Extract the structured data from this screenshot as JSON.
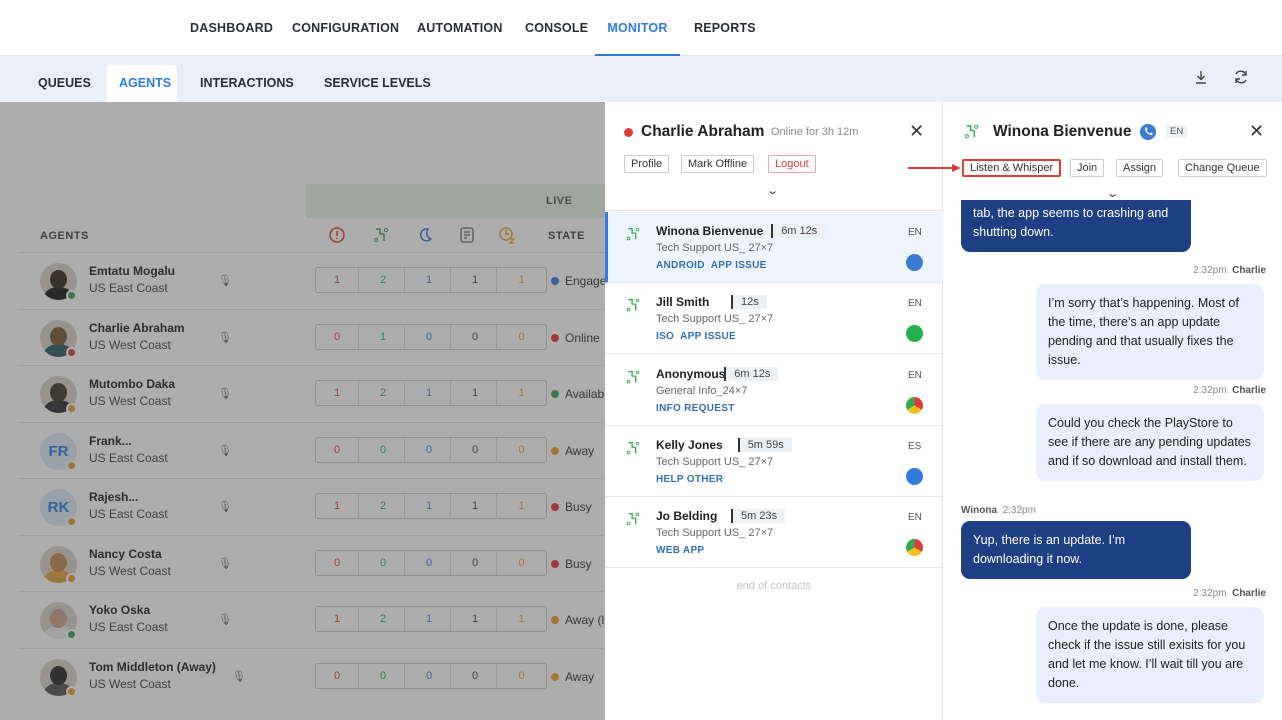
{
  "topnav": {
    "items": [
      "DASHBOARD",
      "CONFIGURATION",
      "AUTOMATION",
      "CONSOLE",
      "MONITOR",
      "REPORTS"
    ],
    "active": "MONITOR"
  },
  "subnav": {
    "tabs": [
      "QUEUES",
      "AGENTS",
      "INTERACTIONS",
      "SERVICE LEVELS"
    ],
    "active": "AGENTS",
    "icons": [
      "download-icon",
      "refresh-icon"
    ]
  },
  "table": {
    "group_label": "LIVE",
    "col_agents": "AGENTS",
    "col_state": "STATE",
    "rows": [
      {
        "name": "Emtatu Mogalu",
        "region": "US East Coast",
        "status": "green",
        "v": [
          "1",
          "2",
          "1",
          "1",
          "1"
        ],
        "state": "Engage",
        "state_color": "#3b7ddd"
      },
      {
        "name": "Charlie Abraham",
        "region": "US West Coast",
        "status": "red",
        "v": [
          "0",
          "1",
          "0",
          "0",
          "0"
        ],
        "state": "Online",
        "state_color": "#e03b3b"
      },
      {
        "name": "Mutombo Daka",
        "region": "US West Coast",
        "status": "orange",
        "v": [
          "1",
          "2",
          "1",
          "1",
          "1"
        ],
        "state": "Availab",
        "state_color": "#35a853"
      },
      {
        "name": "Frank...",
        "region": "US East Coast",
        "status": "orange",
        "initials": "FR",
        "v": [
          "0",
          "0",
          "0",
          "0",
          "0"
        ],
        "state": "Away",
        "state_color": "#f0a030"
      },
      {
        "name": "Rajesh...",
        "region": "US East Coast",
        "status": "orange",
        "initials": "RK",
        "v": [
          "1",
          "2",
          "1",
          "1",
          "1"
        ],
        "state": "Busy",
        "state_color": "#e03b3b"
      },
      {
        "name": "Nancy Costa",
        "region": "US West Coast",
        "status": "orange",
        "v": [
          "0",
          "0",
          "0",
          "0",
          "0"
        ],
        "state": "Busy",
        "state_color": "#e03b3b"
      },
      {
        "name": "Yoko Oska",
        "region": "US East Coast",
        "status": "green",
        "v": [
          "1",
          "2",
          "1",
          "1",
          "1"
        ],
        "state": "Away (l",
        "state_color": "#f0a030"
      },
      {
        "name": "Tom Middleton (Away)",
        "region": "US West Coast",
        "status": "orange",
        "v": [
          "0",
          "0",
          "0",
          "0",
          "0"
        ],
        "state": "Away",
        "state_color": "#f0a030"
      }
    ]
  },
  "agent_panel": {
    "name": "Charlie Abraham",
    "status_text": "Online for 3h 12m",
    "buttons": [
      "Profile",
      "Mark Offline",
      "Logout"
    ],
    "contacts": [
      {
        "name": "Winona Bienvenue",
        "time": "6m 12s",
        "queue": "Tech Support US_ 27×7",
        "tags": [
          "ANDROID",
          "APP ISSUE"
        ],
        "lang": "EN",
        "channel": "phone"
      },
      {
        "name": "Jill Smith",
        "time": "12s",
        "queue": "Tech Support US_ 27×7",
        "tags": [
          "ISO",
          "APP ISSUE"
        ],
        "lang": "EN",
        "channel": "whatsapp"
      },
      {
        "name": "Anonymous",
        "time": "6m 12s",
        "queue": "General Info_24×7",
        "tags": [
          "INFO REQUEST"
        ],
        "lang": "EN",
        "channel": "chrome"
      },
      {
        "name": "Kelly Jones",
        "time": "5m 59s",
        "queue": "Tech Support US_ 27×7",
        "tags": [
          "HELP OTHER"
        ],
        "lang": "ES",
        "channel": "messenger"
      },
      {
        "name": "Jo Belding",
        "time": "5m 23s",
        "queue": "Tech Support US_ 27×7",
        "tags": [
          "WEB APP"
        ],
        "lang": "EN",
        "channel": "chrome"
      }
    ],
    "end_text": "end of contacts"
  },
  "conversation": {
    "name": "Winona Bienvenue",
    "lang": "EN",
    "buttons": [
      "Listen & Whisper",
      "Join",
      "Assign",
      "Change Queue"
    ],
    "messages": [
      {
        "from": "customer",
        "text": "tab, the app seems to crashing and shutting down."
      },
      {
        "from": "agent",
        "time": "2:32pm",
        "sender": "Charlie",
        "text": "I’m sorry that’s happening. Most of the time, there’s an app update pending and that usually fixes the issue."
      },
      {
        "from": "agent",
        "time": "2:32pm",
        "sender": "Charlie",
        "text": "Could you check the PlayStore to see if there are any pending updates and if so download and install them."
      },
      {
        "from": "customer",
        "time": "2:32pm",
        "sender": "Winona",
        "text": "Yup, there is an update. I’m downloading it now."
      },
      {
        "from": "agent",
        "time": "2:32pm",
        "sender": "Charlie",
        "text": "Once the update is done, please check if the issue still exisits for you and let me know. I’ll wait till you are done."
      }
    ]
  },
  "colors": {
    "accent": "#2f7be0",
    "danger": "#e03b3b",
    "bubble_in": "#1e3f83",
    "bubble_out": "#e8eefb"
  }
}
